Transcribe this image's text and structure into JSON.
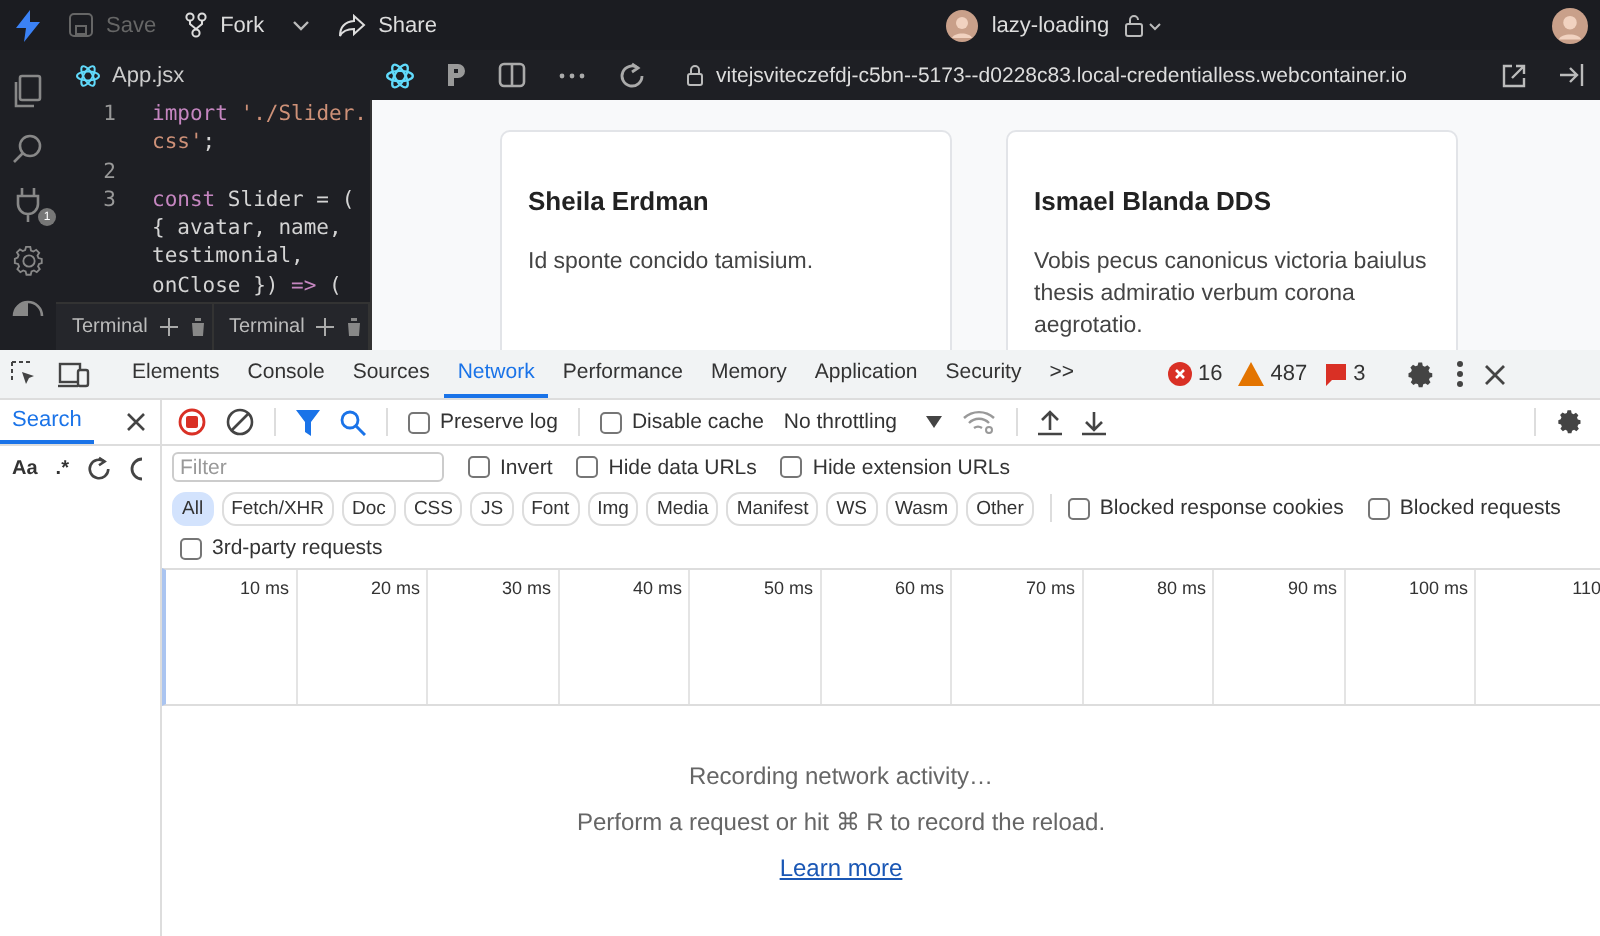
{
  "topbar": {
    "save": {
      "label": "Save",
      "disabled": true
    },
    "fork": "Fork",
    "share": "Share",
    "project": "lazy-loading"
  },
  "editor_tab": "App.jsx",
  "url": "vitejsviteczefdj-c5bn--5173--d0228c83.local-credentialless.webcontainer.io",
  "activity_badge": "1",
  "code": [
    {
      "number": "1",
      "tokens": [
        {
          "kind": "keyword",
          "text": "import"
        },
        {
          "kind": "string",
          "text": " './Slider."
        }
      ]
    },
    {
      "tokens": [
        {
          "kind": "string",
          "text": "css'"
        },
        {
          "kind": "plain",
          "text": ";"
        }
      ]
    },
    {
      "number": "2"
    },
    {
      "number": "3",
      "tokens": [
        {
          "kind": "keyword",
          "text": "const"
        },
        {
          "kind": "plain",
          "text": " Slider = ("
        }
      ]
    },
    {
      "tokens": [
        {
          "kind": "plain",
          "text": "{ avatar, name,"
        }
      ]
    },
    {
      "tokens": [
        {
          "kind": "plain",
          "text": "testimonial,"
        }
      ]
    },
    {
      "tokens": [
        {
          "kind": "plain",
          "text": "onClose })"
        },
        {
          "kind": "keyword",
          "text": " =>"
        },
        {
          "kind": "plain",
          "text": " ("
        }
      ]
    }
  ],
  "terminals": [
    "Terminal",
    "Terminal"
  ],
  "cards": [
    {
      "name": "Sheila Erdman",
      "text": "Id sponte concido tamisium."
    },
    {
      "name": "Ismael Blanda DDS",
      "text": "Vobis pecus canonicus victoria baiulus thesis admiratio verbum corona aegrotatio."
    }
  ],
  "devtools": {
    "tabs": [
      {
        "label": "Elements",
        "selected": false
      },
      {
        "label": "Console",
        "selected": false
      },
      {
        "label": "Sources",
        "selected": false
      },
      {
        "label": "Network",
        "selected": true
      },
      {
        "label": "Performance",
        "selected": false
      },
      {
        "label": "Memory",
        "selected": false
      },
      {
        "label": "Application",
        "selected": false
      },
      {
        "label": "Security",
        "selected": false
      }
    ],
    "more": ">>",
    "errors": "16",
    "warnings": "487",
    "issues": "3",
    "side_tab": {
      "label": "Search",
      "selected": true
    },
    "side_options": [
      "Aa",
      ".*"
    ],
    "preserve_log": {
      "label": "Preserve log",
      "checked": false
    },
    "disable_cache": {
      "label": "Disable cache",
      "checked": false
    },
    "throttling": "No throttling",
    "filter": {
      "placeholder": "Filter"
    },
    "filter_options": [
      {
        "label": "Invert",
        "checked": false
      },
      {
        "label": "Hide data URLs",
        "checked": false
      },
      {
        "label": "Hide extension URLs",
        "checked": false
      }
    ],
    "types": [
      {
        "label": "All",
        "selected": true
      },
      {
        "label": "Fetch/XHR",
        "selected": false
      },
      {
        "label": "Doc",
        "selected": false
      },
      {
        "label": "CSS",
        "selected": false
      },
      {
        "label": "JS",
        "selected": false
      },
      {
        "label": "Font",
        "selected": false
      },
      {
        "label": "Img",
        "selected": false
      },
      {
        "label": "Media",
        "selected": false
      },
      {
        "label": "Manifest",
        "selected": false
      },
      {
        "label": "WS",
        "selected": false
      },
      {
        "label": "Wasm",
        "selected": false
      },
      {
        "label": "Other",
        "selected": false
      }
    ],
    "blocked_options": [
      {
        "label": "Blocked response cookies",
        "checked": false
      },
      {
        "label": "Blocked requests",
        "checked": false
      }
    ],
    "third_party": {
      "label": "3rd-party requests",
      "checked": false
    },
    "timeline_ticks": [
      "10 ms",
      "20 ms",
      "30 ms",
      "40 ms",
      "50 ms",
      "60 ms",
      "70 ms",
      "80 ms",
      "90 ms",
      "100 ms",
      "110"
    ],
    "status": "Recording network activity…",
    "hint": "Perform a request or hit ⌘ R to record the reload.",
    "link": "Learn more"
  }
}
